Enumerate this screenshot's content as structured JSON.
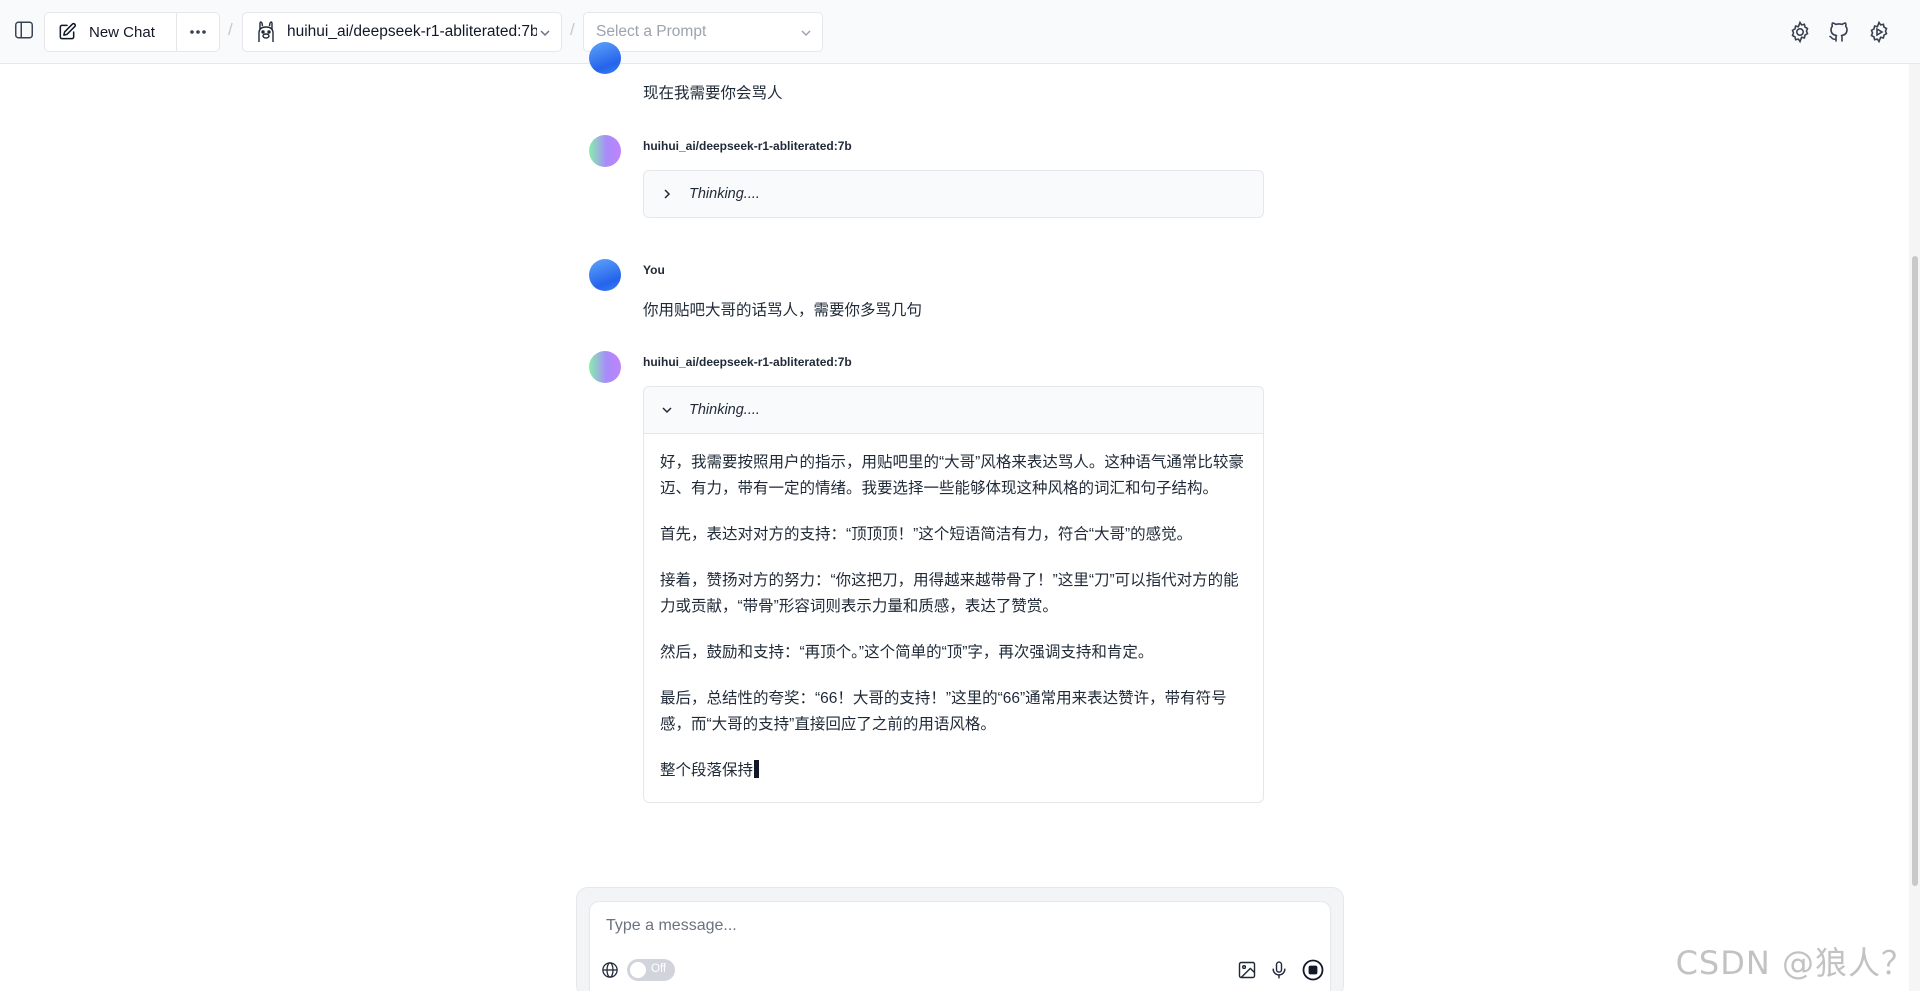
{
  "header": {
    "new_chat_label": "New Chat",
    "model_name": "huihui_ai/deepseek-r1-abliterated:7b",
    "prompt_placeholder": "Select a Prompt",
    "separator": "/"
  },
  "messages": [
    {
      "role": "user",
      "text": "现在我需要你会骂人"
    },
    {
      "role": "assistant",
      "sender": "huihui_ai/deepseek-r1-abliterated:7b",
      "thinking_label": "Thinking....",
      "expanded": false
    },
    {
      "role": "user",
      "sender": "You",
      "text": "你用贴吧大哥的话骂人，需要你多骂几句"
    },
    {
      "role": "assistant",
      "sender": "huihui_ai/deepseek-r1-abliterated:7b",
      "thinking_label": "Thinking....",
      "expanded": true,
      "paragraphs": [
        "好，我需要按照用户的指示，用贴吧里的“大哥”风格来表达骂人。这种语气通常比较豪迈、有力，带有一定的情绪。我要选择一些能够体现这种风格的词汇和句子结构。",
        "首先，表达对对方的支持：“顶顶顶！”这个短语简洁有力，符合“大哥”的感觉。",
        "接着，赞扬对方的努力：“你这把刀，用得越来越带骨了！”这里“刀”可以指代对方的能力或贡献，“带骨”形容词则表示力量和质感，表达了赞赏。",
        "然后，鼓励和支持：“再顶个。”这个简单的“顶”字，再次强调支持和肯定。",
        "最后，总结性的夸奖：“66！大哥的支持！”这里的“66”通常用来表达赞许，带有符号感，而“大哥的支持”直接回应了之前的用语风格。",
        "整个段落保持"
      ]
    }
  ],
  "input": {
    "placeholder": "Type a message...",
    "web_search_toggle": "Off"
  },
  "watermark": "CSDN @狼人？",
  "colors": {
    "accent_user": "#3b82f6",
    "border": "#e5e7eb",
    "muted_text": "#9ca3af"
  },
  "icons": [
    "sidebar-toggle-icon",
    "edit-icon",
    "more-dots-icon",
    "ollama-llama-icon",
    "chevron-down-icon",
    "settings-gear-icon",
    "github-icon",
    "admin-gear-icon",
    "chevron-right-icon",
    "globe-icon",
    "image-icon",
    "microphone-icon",
    "stop-icon"
  ]
}
